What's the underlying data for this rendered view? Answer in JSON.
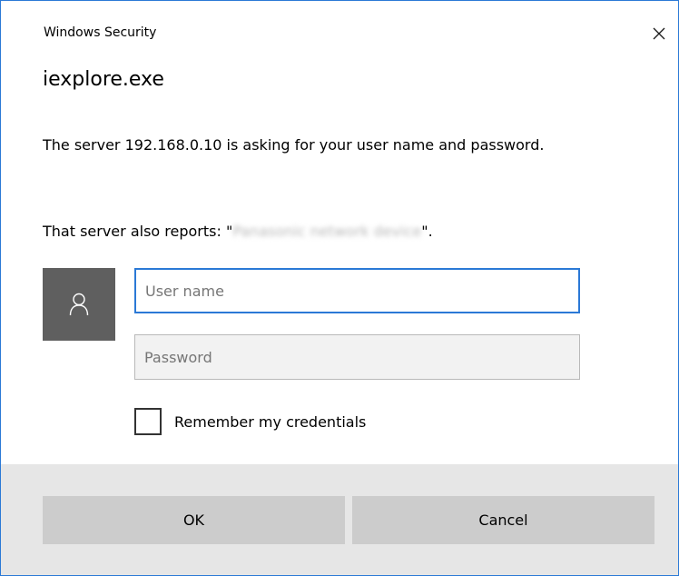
{
  "dialog": {
    "title": "Windows Security",
    "app_name": "iexplore.exe",
    "message": "The server 192.168.0.10 is asking for your user name and password.",
    "reports_prefix": "That server also reports: \"",
    "reports_realm": "Panasonic network device",
    "reports_suffix": "\"."
  },
  "form": {
    "username_placeholder": "User name",
    "password_placeholder": "Password",
    "username_value": "",
    "password_value": "",
    "remember_label": "Remember my credentials",
    "remember_checked": false
  },
  "buttons": {
    "ok_label": "OK",
    "cancel_label": "Cancel"
  },
  "icons": {
    "close": "close-icon",
    "user": "user-icon"
  },
  "colors": {
    "accent": "#2b79d6",
    "tile": "#5f5f5f",
    "button": "#cccccc",
    "footer": "#e6e6e6"
  }
}
